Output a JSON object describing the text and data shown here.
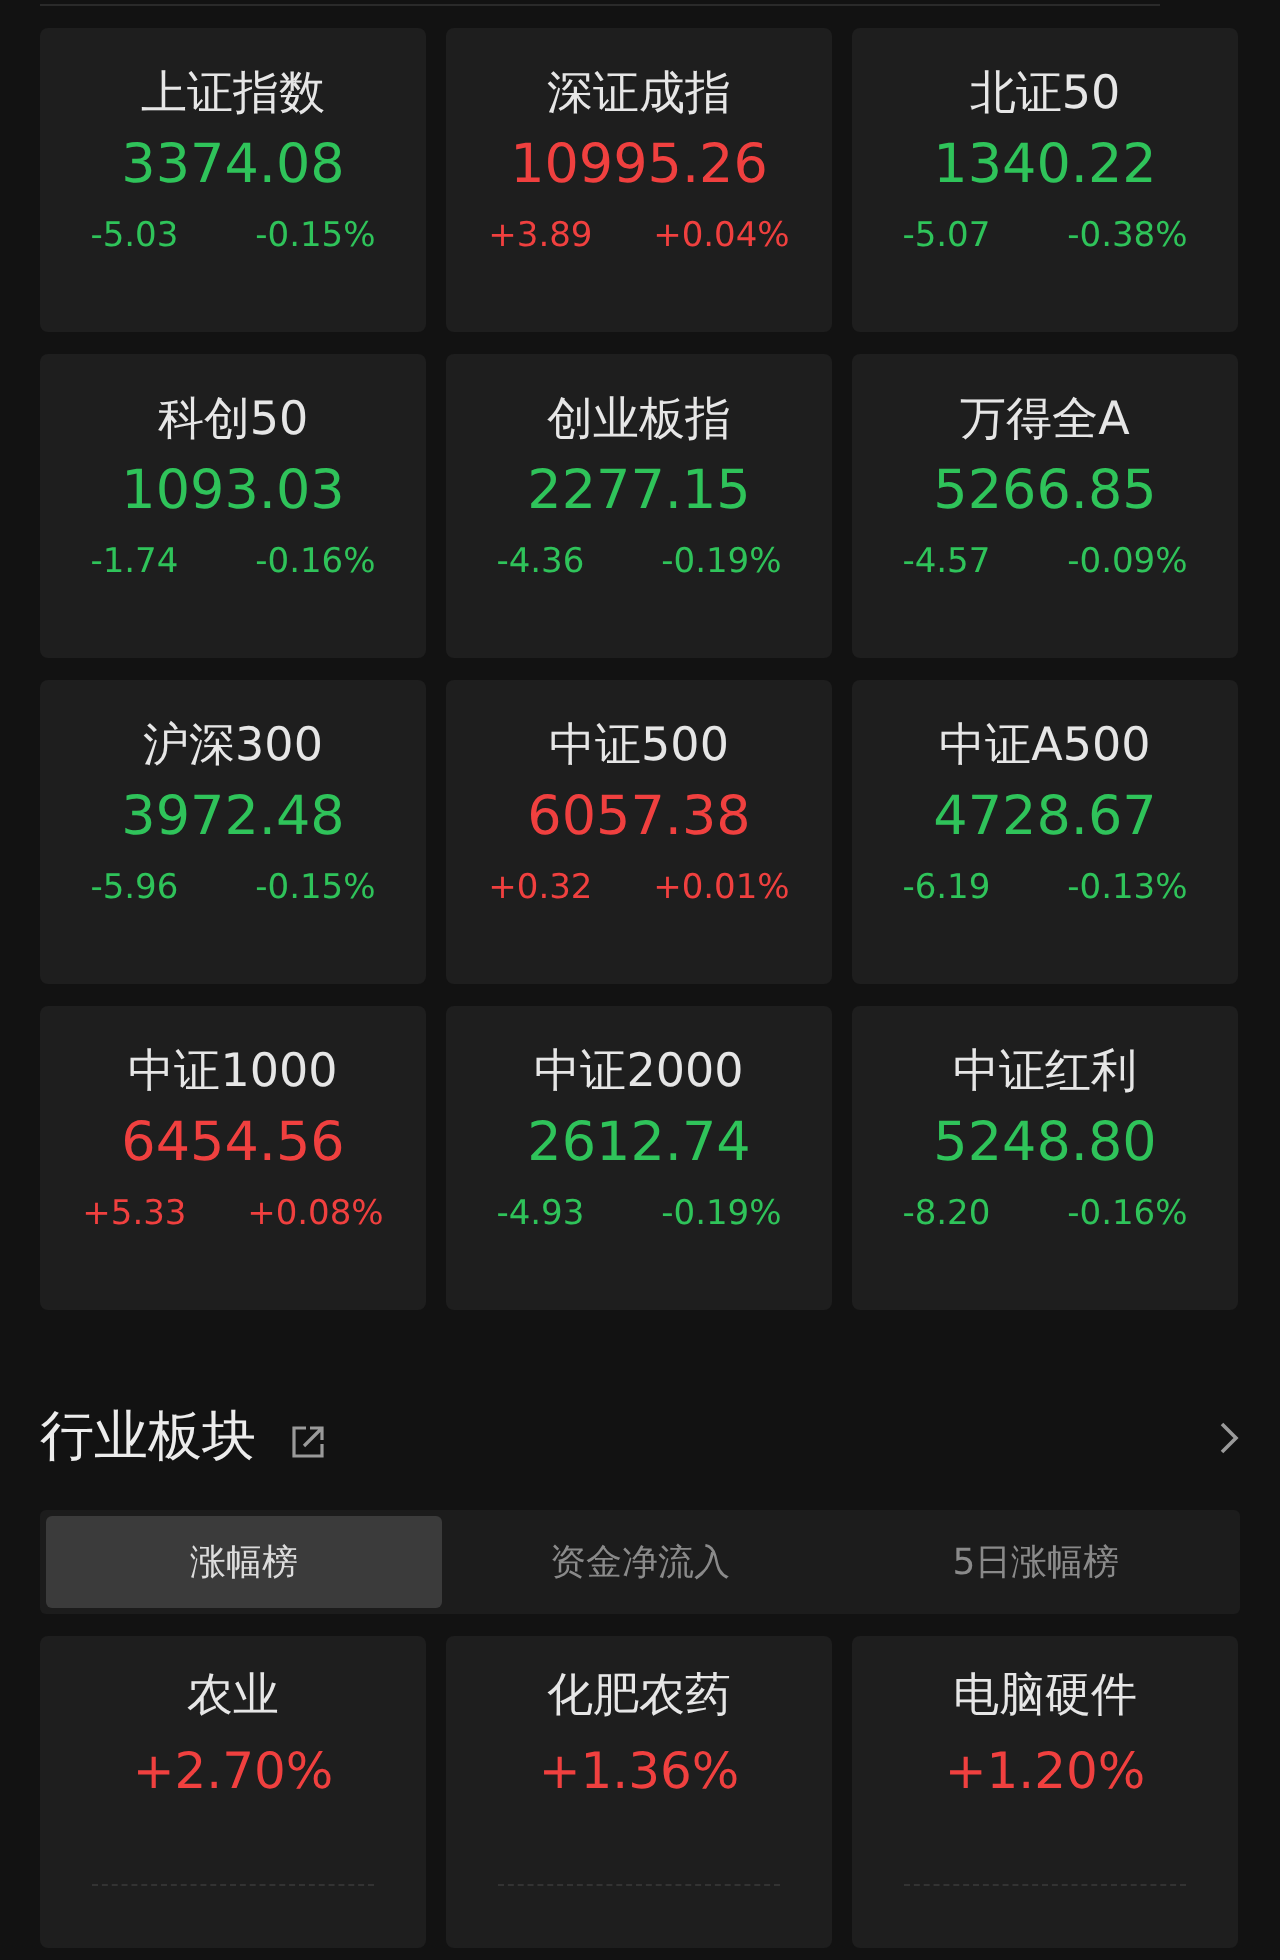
{
  "indices": [
    {
      "name": "上证指数",
      "value": "3374.08",
      "change": "-5.03",
      "percent": "-0.15%",
      "color": "#2fc35a"
    },
    {
      "name": "深证成指",
      "value": "10995.26",
      "change": "+3.89",
      "percent": "+0.04%",
      "color": "#f0403f"
    },
    {
      "name": "北证50",
      "value": "1340.22",
      "change": "-5.07",
      "percent": "-0.38%",
      "color": "#2fc35a"
    },
    {
      "name": "科创50",
      "value": "1093.03",
      "change": "-1.74",
      "percent": "-0.16%",
      "color": "#2fc35a"
    },
    {
      "name": "创业板指",
      "value": "2277.15",
      "change": "-4.36",
      "percent": "-0.19%",
      "color": "#2fc35a"
    },
    {
      "name": "万得全A",
      "value": "5266.85",
      "change": "-4.57",
      "percent": "-0.09%",
      "color": "#2fc35a"
    },
    {
      "name": "沪深300",
      "value": "3972.48",
      "change": "-5.96",
      "percent": "-0.15%",
      "color": "#2fc35a"
    },
    {
      "name": "中证500",
      "value": "6057.38",
      "change": "+0.32",
      "percent": "+0.01%",
      "color": "#f0403f"
    },
    {
      "name": "中证A500",
      "value": "4728.67",
      "change": "-6.19",
      "percent": "-0.13%",
      "color": "#2fc35a"
    },
    {
      "name": "中证1000",
      "value": "6454.56",
      "change": "+5.33",
      "percent": "+0.08%",
      "color": "#f0403f"
    },
    {
      "name": "中证2000",
      "value": "2612.74",
      "change": "-4.93",
      "percent": "-0.19%",
      "color": "#2fc35a"
    },
    {
      "name": "中证红利",
      "value": "5248.80",
      "change": "-8.20",
      "percent": "-0.16%",
      "color": "#2fc35a"
    }
  ],
  "sector": {
    "title": "行业板块",
    "tabs": [
      {
        "label": "涨幅榜",
        "selected": true
      },
      {
        "label": "资金净流入",
        "selected": false
      },
      {
        "label": "5日涨幅榜",
        "selected": false
      }
    ],
    "items": [
      {
        "name": "农业",
        "percent": "+2.70%",
        "color": "#f0403f"
      },
      {
        "name": "化肥农药",
        "percent": "+1.36%",
        "color": "#f0403f"
      },
      {
        "name": "电脑硬件",
        "percent": "+1.20%",
        "color": "#f0403f"
      }
    ]
  }
}
